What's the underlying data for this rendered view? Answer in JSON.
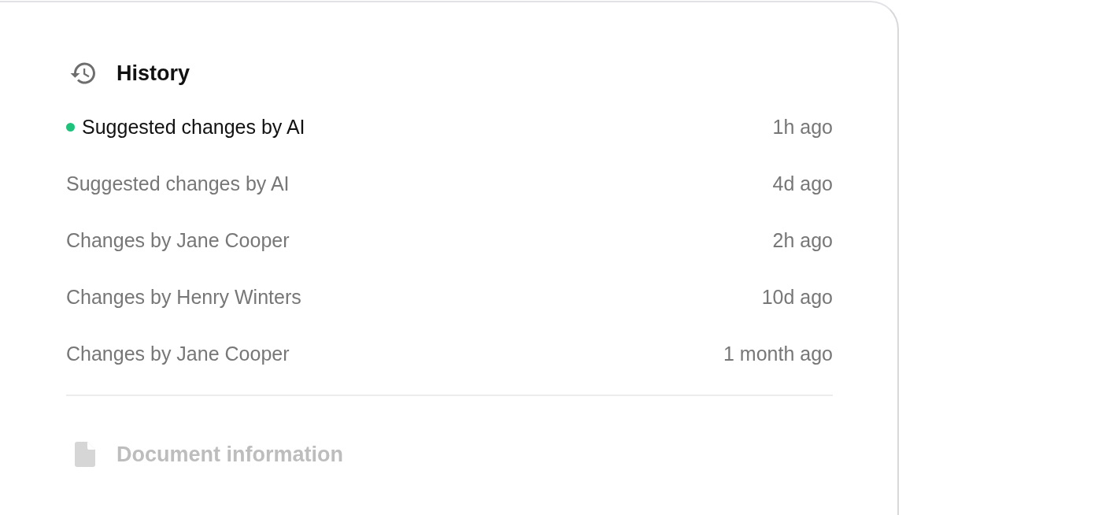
{
  "history": {
    "title": "History",
    "items": [
      {
        "label": "Suggested changes by AI",
        "time": "1h ago",
        "selected": true
      },
      {
        "label": "Suggested changes by AI",
        "time": "4d ago",
        "selected": false
      },
      {
        "label": "Changes by Jane Cooper",
        "time": "2h ago",
        "selected": false
      },
      {
        "label": "Changes by Henry Winters",
        "time": "10d ago",
        "selected": false
      },
      {
        "label": "Changes by Jane Cooper",
        "time": "1 month ago",
        "selected": false
      }
    ]
  },
  "document_information": {
    "title": "Document information",
    "disabled": true
  }
}
